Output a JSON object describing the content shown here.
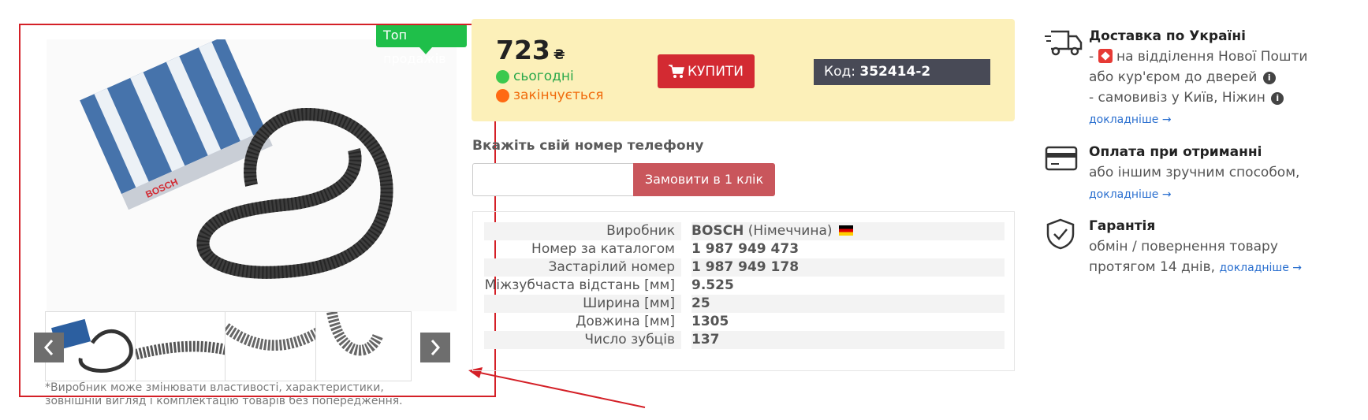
{
  "gallery": {
    "badge": "Топ продажів",
    "thumbnails": [
      "thumb-1",
      "thumb-2",
      "thumb-3",
      "thumb-4"
    ],
    "prev_icon": "chevron-left-icon",
    "next_icon": "chevron-right-icon",
    "disclaimer": "*Виробник може змінювати властивості, характеристики, зовнішній вигляд і комплектацію товарів без попередження.",
    "product_box_brand": "BOSCH"
  },
  "price_panel": {
    "price": "723",
    "currency": "₴",
    "stock_today": "сьогодні",
    "stock_ending": "закінчується",
    "buy_label": "КУПИТИ",
    "code_label": "Код:",
    "code_value": "352414-2"
  },
  "phone_order": {
    "label": "Вкажіть свій номер телефону",
    "input_value": "",
    "button_label": "Замовити в 1 клік"
  },
  "specs": [
    {
      "label": "Виробник",
      "value": "BOSCH",
      "note": "(Німеччина)"
    },
    {
      "label": "Номер за каталогом",
      "value": "1 987 949 473"
    },
    {
      "label": "Застарілий номер",
      "value": "1 987 949 178"
    },
    {
      "label": "Міжзубчаста відстань [мм]",
      "value": "9.525"
    },
    {
      "label": "Ширина [мм]",
      "value": "25"
    },
    {
      "label": "Довжина [мм]",
      "value": "1305"
    },
    {
      "label": "Число зубців",
      "value": "137"
    }
  ],
  "info": {
    "delivery": {
      "title": "Доставка по Україні",
      "line1_prefix": "-",
      "line1_text": "на відділення Нової Пошти",
      "line2": "або кур'єром до дверей",
      "line3": "- самовивіз у Київ, Ніжин",
      "more": "докладніше →"
    },
    "payment": {
      "title": "Оплата при отриманні",
      "line1": "або іншим зручним способом,",
      "more": "докладніше →"
    },
    "warranty": {
      "title": "Гарантія",
      "line1": "обмін / повернення товару",
      "line2": "протягом 14 днів,",
      "more": "докладніше →"
    }
  },
  "colors": {
    "badge_green": "#1fbf4a",
    "buy_red": "#d32a32",
    "panel_yellow": "#fcf0b9",
    "code_dark": "#484a56",
    "annotation_red": "#d42027"
  }
}
